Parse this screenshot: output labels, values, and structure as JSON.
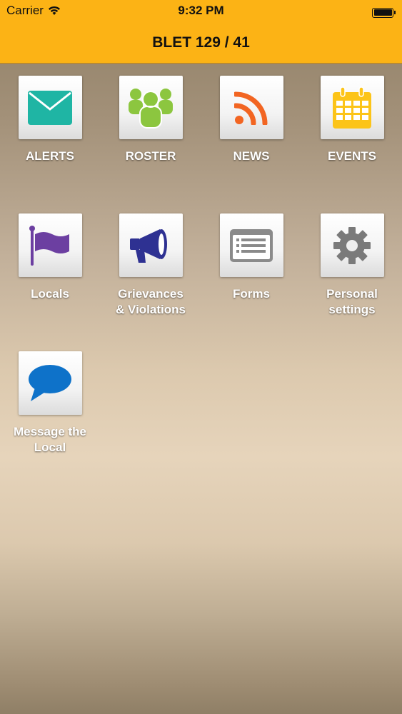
{
  "status_bar": {
    "carrier": "Carrier",
    "time": "9:32 PM"
  },
  "header": {
    "title": "BLET 129 / 41"
  },
  "colors": {
    "header_bg": "#fcb315",
    "alerts": "#1fb5a4",
    "roster": "#8cc63f",
    "news": "#f26522",
    "events": "#fcc418",
    "locals": "#6c3fa1",
    "grievances": "#2e3192",
    "forms": "#8a8a8a",
    "settings": "#7a7a7a",
    "message": "#0e72c9"
  },
  "tiles": [
    {
      "label": "ALERTS",
      "icon": "envelope-icon"
    },
    {
      "label": "ROSTER",
      "icon": "people-icon"
    },
    {
      "label": "NEWS",
      "icon": "rss-icon"
    },
    {
      "label": "EVENTS",
      "icon": "calendar-icon"
    },
    {
      "label": "Locals",
      "icon": "flag-icon"
    },
    {
      "label": "Grievances\n& Violations",
      "icon": "megaphone-icon"
    },
    {
      "label": "Forms",
      "icon": "form-icon"
    },
    {
      "label": "Personal\nsettings",
      "icon": "gear-icon"
    },
    {
      "label": "Message the\nLocal",
      "icon": "speech-bubble-icon"
    }
  ]
}
